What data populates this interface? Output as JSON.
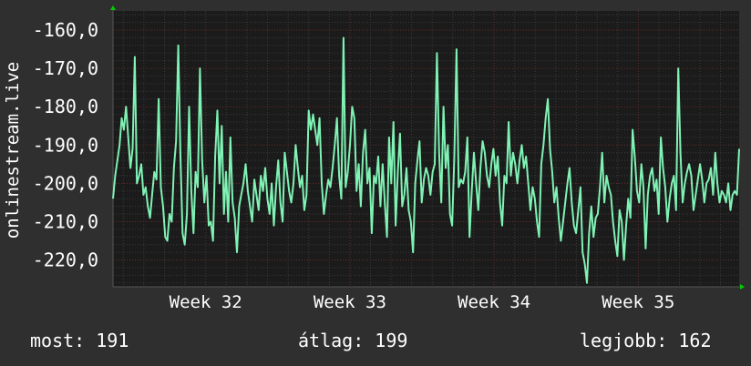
{
  "colors": {
    "background": "#2f2f2f",
    "plot_background": "#1b1b1b",
    "line": "#7ff2b4",
    "grid_major": "#6b2a2a",
    "grid_minor": "#3a3a3a",
    "axis_arrow": "#00cc00",
    "text": "#ffffff"
  },
  "stats": {
    "now": "most: 191",
    "avg": "átlag: 199",
    "best": "legjobb: 162"
  },
  "chart_data": {
    "type": "line",
    "title": "",
    "ylabel": "onlinestream.live",
    "xlabel": "",
    "ylim": [
      -227,
      -155
    ],
    "yticks": [
      -160,
      -170,
      -180,
      -190,
      -200,
      -210,
      -220
    ],
    "ytick_labels": [
      "-160,0",
      "-170,0",
      "-180,0",
      "-190,0",
      "-200,0",
      "-210,0",
      "-220,0"
    ],
    "xlim": [
      0,
      30.4
    ],
    "xticks": [
      4.5,
      11.5,
      18.5,
      25.5
    ],
    "xtick_labels": [
      "Week 32",
      "Week 33",
      "Week 34",
      "Week 35"
    ],
    "grid": true,
    "series": [
      {
        "values": [
          -204,
          -198,
          -194,
          -190,
          -183,
          -186,
          -180,
          -188,
          -196,
          -191,
          -167,
          -200,
          -198,
          -195,
          -203,
          -201,
          -206,
          -209,
          -203,
          -197,
          -199,
          -178,
          -201,
          -206,
          -214,
          -215,
          -208,
          -210,
          -196,
          -189,
          -164,
          -192,
          -213,
          -216,
          -208,
          -180,
          -202,
          -213,
          -197,
          -201,
          -170,
          -194,
          -205,
          -198,
          -211,
          -210,
          -215,
          -193,
          -181,
          -200,
          -185,
          -208,
          -197,
          -210,
          -188,
          -205,
          -209,
          -218,
          -206,
          -203,
          -200,
          -195,
          -202,
          -206,
          -210,
          -199,
          -203,
          -207,
          -198,
          -202,
          -196,
          -204,
          -208,
          -200,
          -211,
          -201,
          -194,
          -205,
          -210,
          -192,
          -197,
          -202,
          -205,
          -200,
          -190,
          -196,
          -201,
          -198,
          -207,
          -203,
          -181,
          -186,
          -182,
          -186,
          -190,
          -183,
          -200,
          -208,
          -203,
          -199,
          -201,
          -196,
          -190,
          -183,
          -198,
          -204,
          -162,
          -201,
          -197,
          -190,
          -180,
          -183,
          -202,
          -195,
          -206,
          -192,
          -186,
          -200,
          -196,
          -213,
          -198,
          -200,
          -193,
          -206,
          -195,
          -205,
          -214,
          -188,
          -200,
          -184,
          -211,
          -197,
          -187,
          -206,
          -203,
          -196,
          -207,
          -210,
          -218,
          -200,
          -194,
          -189,
          -205,
          -199,
          -196,
          -198,
          -203,
          -197,
          -195,
          -166,
          -192,
          -205,
          -180,
          -196,
          -190,
          -208,
          -211,
          -193,
          -165,
          -201,
          -199,
          -200,
          -197,
          -188,
          -214,
          -202,
          -192,
          -200,
          -207,
          -196,
          -189,
          -192,
          -198,
          -201,
          -195,
          -191,
          -198,
          -193,
          -205,
          -211,
          -198,
          -200,
          -184,
          -198,
          -192,
          -195,
          -200,
          -194,
          -190,
          -196,
          -193,
          -200,
          -207,
          -201,
          -204,
          -210,
          -214,
          -195,
          -190,
          -183,
          -178,
          -191,
          -197,
          -205,
          -201,
          -209,
          -215,
          -210,
          -205,
          -200,
          -196,
          -205,
          -211,
          -213,
          -207,
          -201,
          -218,
          -221,
          -226,
          -213,
          -206,
          -214,
          -209,
          -208,
          -201,
          -192,
          -205,
          -198,
          -201,
          -203,
          -210,
          -215,
          -219,
          -207,
          -210,
          -220,
          -211,
          -204,
          -209,
          -186,
          -193,
          -202,
          -205,
          -195,
          -201,
          -217,
          -203,
          -198,
          -196,
          -202,
          -199,
          -208,
          -188,
          -196,
          -201,
          -210,
          -204,
          -200,
          -198,
          -207,
          -170,
          -192,
          -205,
          -200,
          -197,
          -195,
          -198,
          -207,
          -203,
          -199,
          -195,
          -199,
          -205,
          -200,
          -199,
          -196,
          -203,
          -192,
          -200,
          -205,
          -202,
          -203,
          -205,
          -200,
          -207,
          -203,
          -202,
          -203,
          -191
        ]
      }
    ]
  }
}
